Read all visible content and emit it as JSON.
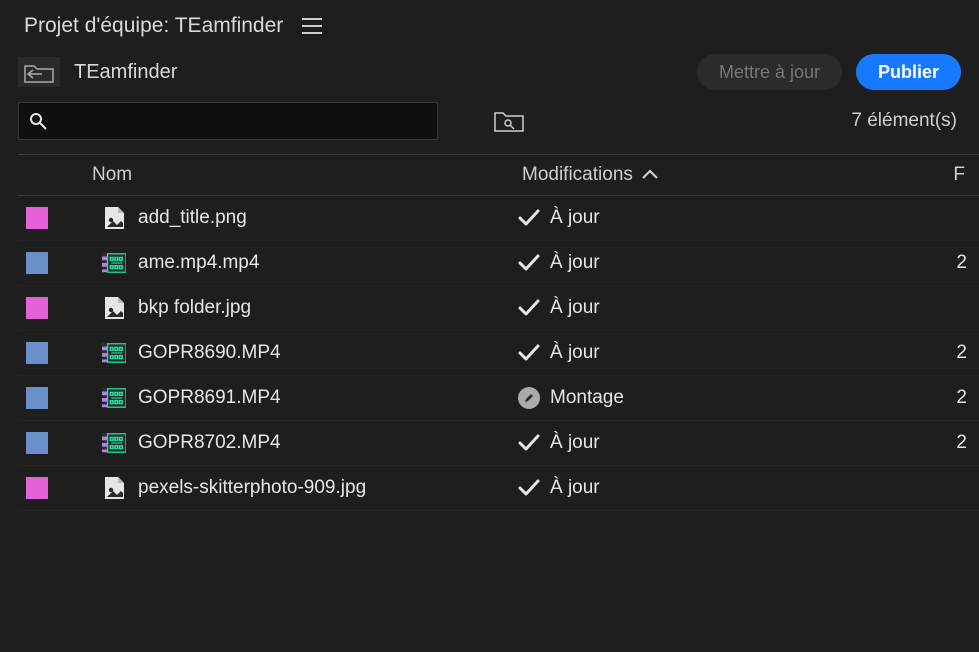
{
  "header": {
    "title": "Projet d'équipe: TEamfinder"
  },
  "toolbar": {
    "breadcrumb": "TEamfinder",
    "update_label": "Mettre à jour",
    "publish_label": "Publier"
  },
  "search": {
    "placeholder": "",
    "value": "",
    "count_label": "7 élément(s)"
  },
  "columns": {
    "name": "Nom",
    "modifications": "Modifications",
    "f": "F"
  },
  "rows": [
    {
      "color": "pink",
      "type": "image",
      "name": "add_title.png",
      "mod_icon": "check",
      "mod_text": "À jour",
      "f": ""
    },
    {
      "color": "blue",
      "type": "video",
      "name": "ame.mp4.mp4",
      "mod_icon": "check",
      "mod_text": "À jour",
      "f": "2"
    },
    {
      "color": "pink",
      "type": "image",
      "name": "bkp folder.jpg",
      "mod_icon": "check",
      "mod_text": "À jour",
      "f": ""
    },
    {
      "color": "blue",
      "type": "video",
      "name": "GOPR8690.MP4",
      "mod_icon": "check",
      "mod_text": "À jour",
      "f": "2"
    },
    {
      "color": "blue",
      "type": "video",
      "name": "GOPR8691.MP4",
      "mod_icon": "edit",
      "mod_text": "Montage",
      "f": "2"
    },
    {
      "color": "blue",
      "type": "video",
      "name": "GOPR8702.MP4",
      "mod_icon": "check",
      "mod_text": "À jour",
      "f": "2"
    },
    {
      "color": "pink",
      "type": "image",
      "name": "pexels-skitterphoto-909.jpg",
      "mod_icon": "check",
      "mod_text": "À jour",
      "f": ""
    }
  ]
}
